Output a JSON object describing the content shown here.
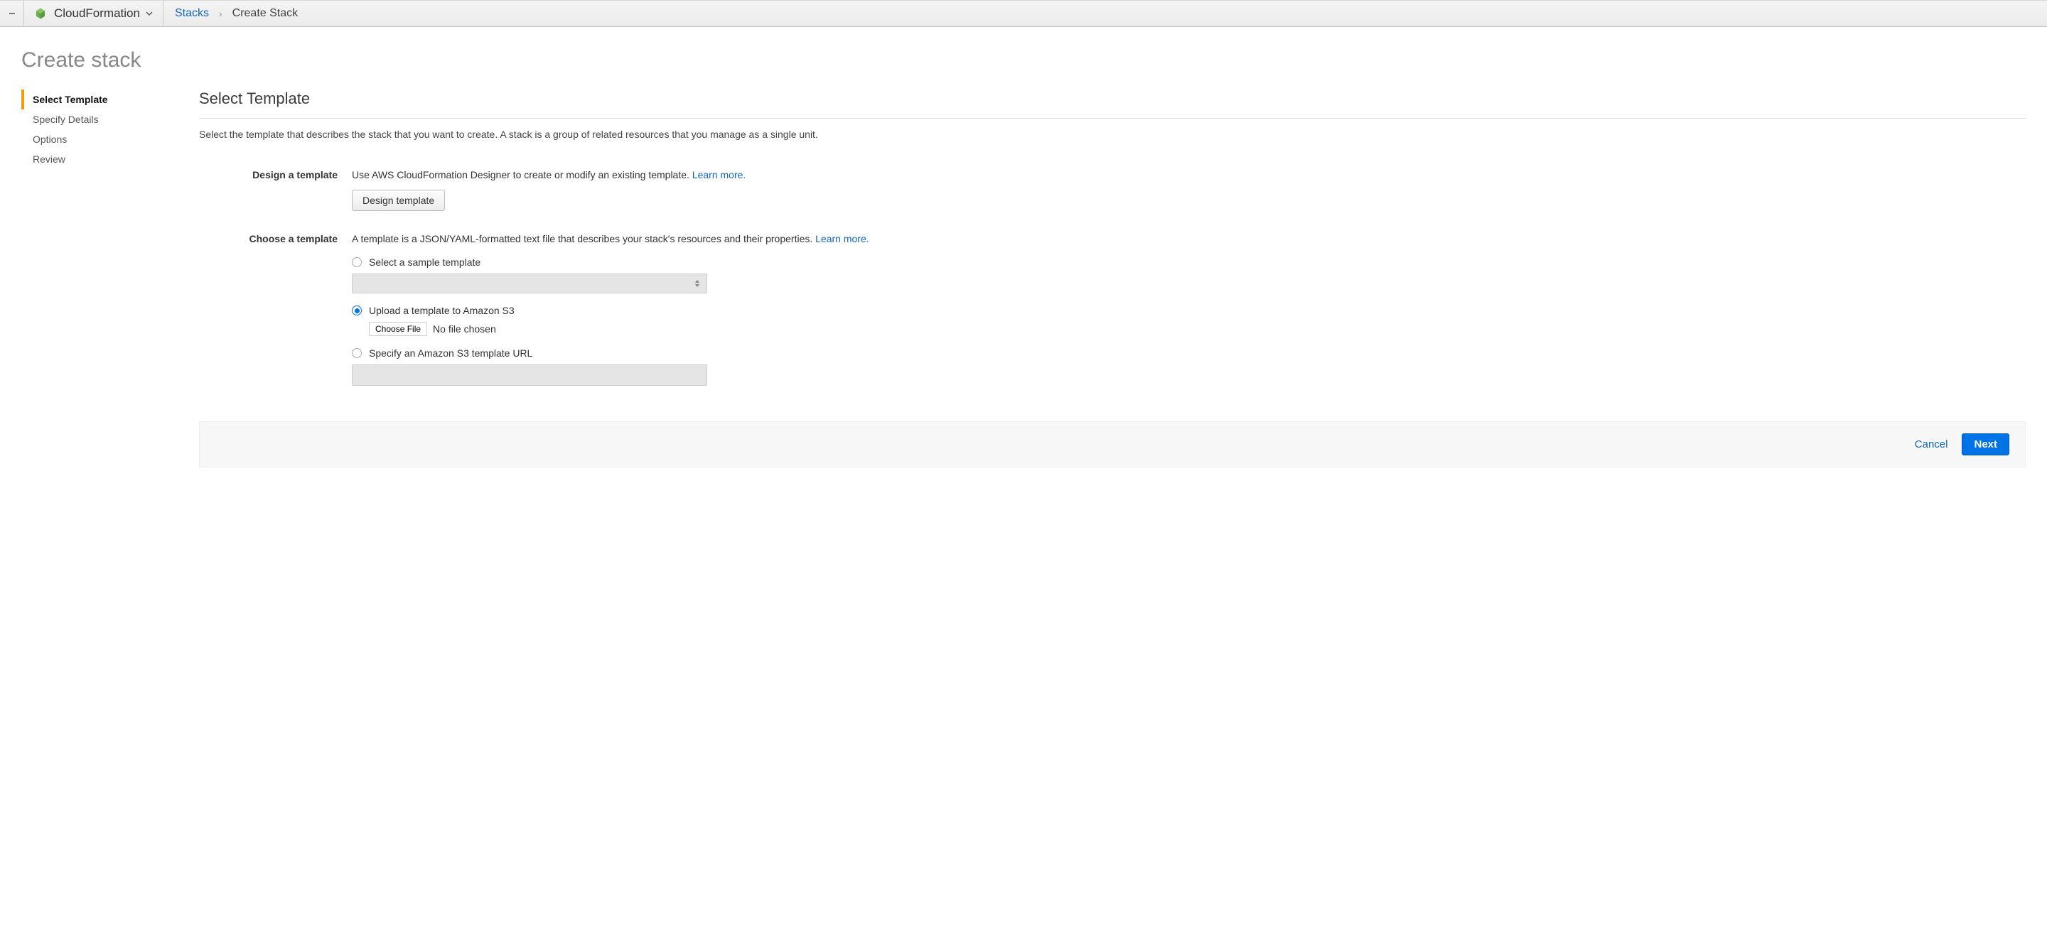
{
  "topbar": {
    "service_name": "CloudFormation",
    "breadcrumb_link": "Stacks",
    "breadcrumb_current": "Create Stack"
  },
  "page_title": "Create stack",
  "steps": [
    {
      "label": "Select Template",
      "active": true
    },
    {
      "label": "Specify Details",
      "active": false
    },
    {
      "label": "Options",
      "active": false
    },
    {
      "label": "Review",
      "active": false
    }
  ],
  "section": {
    "title": "Select Template",
    "description": "Select the template that describes the stack that you want to create. A stack is a group of related resources that you manage as a single unit."
  },
  "design": {
    "label": "Design a template",
    "text": "Use AWS CloudFormation Designer to create or modify an existing template. ",
    "learn_more": "Learn more.",
    "button": "Design template"
  },
  "choose": {
    "label": "Choose a template",
    "text": "A template is a JSON/YAML-formatted text file that describes your stack's resources and their properties. ",
    "learn_more": "Learn more.",
    "option_sample": "Select a sample template",
    "option_upload": "Upload a template to Amazon S3",
    "file_button": "Choose File",
    "file_status": "No file chosen",
    "option_url": "Specify an Amazon S3 template URL",
    "url_value": ""
  },
  "footer": {
    "cancel": "Cancel",
    "next": "Next"
  },
  "colors": {
    "accent_orange": "#f59c00",
    "link_blue": "#1166bb",
    "primary_blue": "#0073e6"
  }
}
